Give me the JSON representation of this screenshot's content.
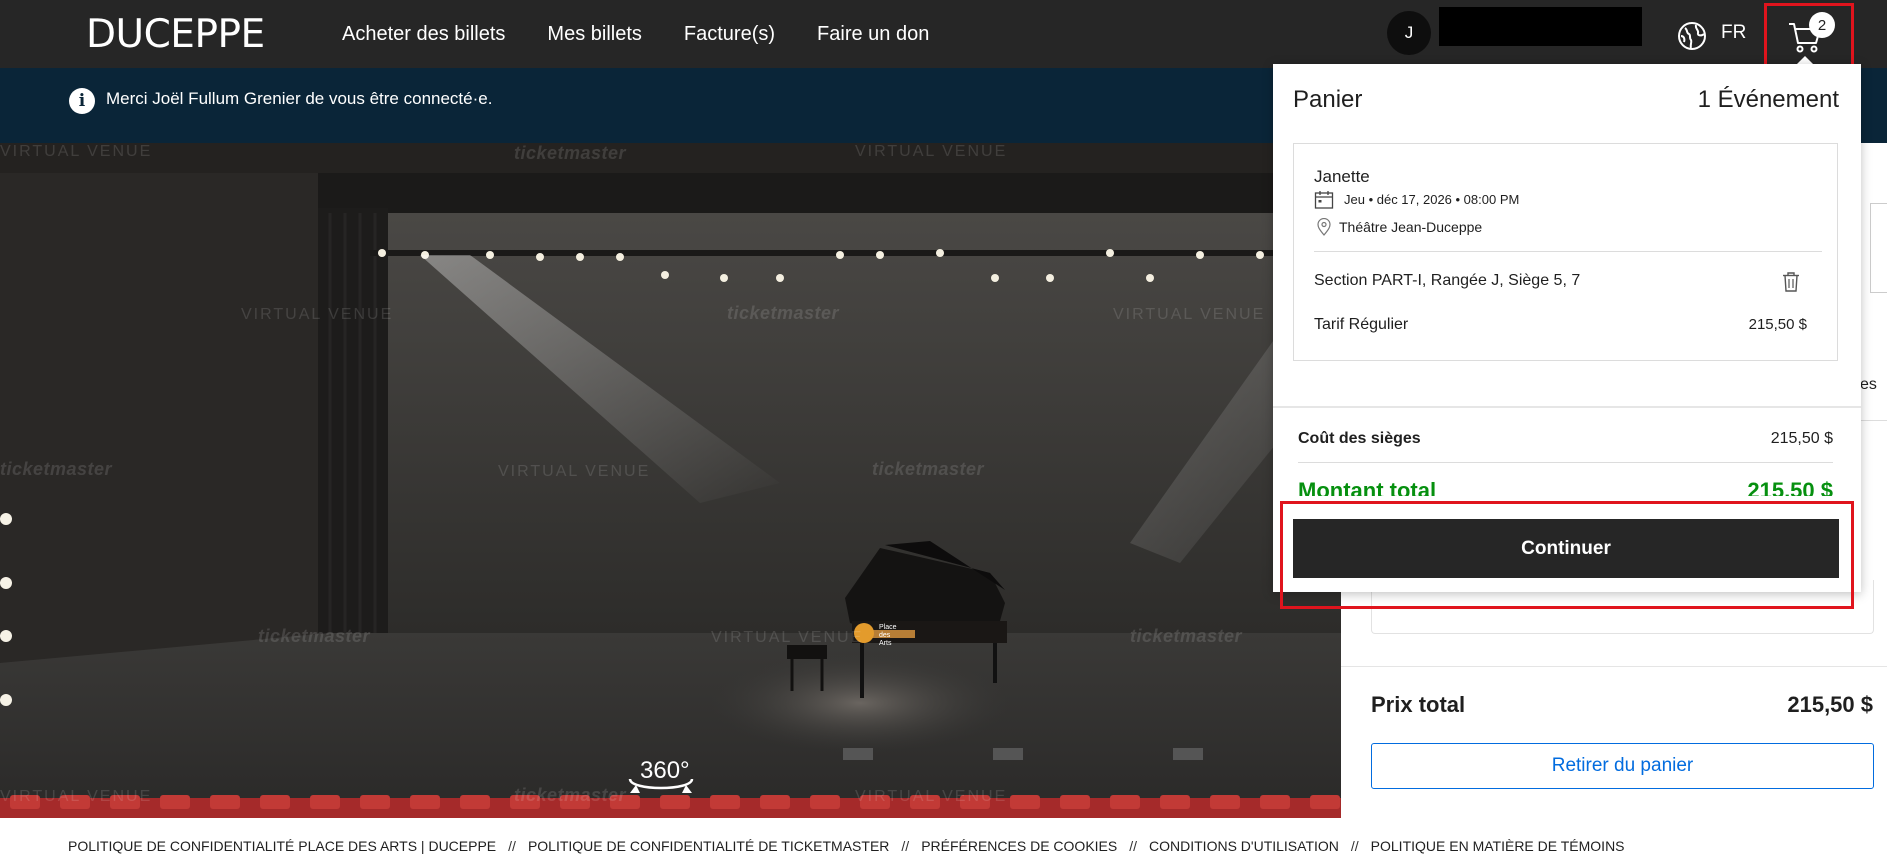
{
  "header": {
    "logo": "DUCEPPE",
    "nav": [
      "Acheter des billets",
      "Mes billets",
      "Facture(s)",
      "Faire un don"
    ],
    "avatar_initial": "J",
    "language": "FR",
    "cart_count": "2",
    "icons": {
      "globe": "globe-icon",
      "cart": "cart-icon"
    }
  },
  "banner": {
    "message": "Merci Joël Fullum Grenier de vous être connecté·e.",
    "icon": "info-icon"
  },
  "stage": {
    "badge": "360°",
    "watermarks": {
      "ticketmaster": "ticketmaster",
      "virtual_venue": "VIRTUAL VENUE"
    },
    "piano_brand": "Place des Arts"
  },
  "side_panel": {
    "fragment_text": "es",
    "total_label": "Prix total",
    "total_value": "215,50 $",
    "remove_button": "Retirer du panier"
  },
  "cart_popup": {
    "title": "Panier",
    "event_count": "1 Événement",
    "event": {
      "name": "Janette",
      "date": "Jeu • déc 17, 2026 • 08:00 PM",
      "venue": "Théâtre Jean-Duceppe",
      "seats": "Section PART-I, Rangée J, Siège 5, 7",
      "tarif_label": "Tarif Régulier",
      "tarif_price": "215,50 $"
    },
    "seat_cost_label": "Coût des sièges",
    "seat_cost_value": "215,50 $",
    "total_label": "Montant total",
    "total_value": "215,50 $",
    "continue_button": "Continuer"
  },
  "footer": {
    "links": [
      "POLITIQUE DE CONFIDENTIALITÉ PLACE DES ARTS | DUCEPPE",
      "POLITIQUE DE CONFIDENTIALITÉ DE TICKETMASTER",
      "PRÉFÉRENCES DE COOKIES",
      "CONDITIONS D'UTILISATION",
      "POLITIQUE EN MATIÈRE DE TÉMOINS"
    ],
    "separator": "//"
  },
  "colors": {
    "topbar": "#262626",
    "banner": "#0a2538",
    "highlight": "#e0141d",
    "total_green": "#06900f",
    "link_blue": "#026cdf"
  }
}
